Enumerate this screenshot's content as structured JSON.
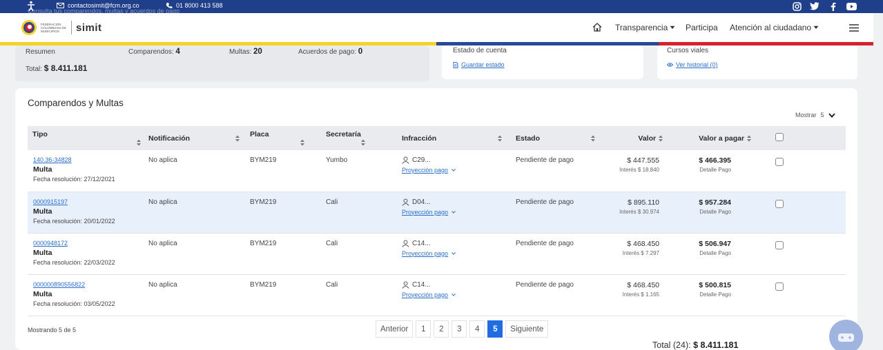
{
  "topbar": {
    "email": "contactosimit@fcm.org.co",
    "phone": "01 8000 413 588",
    "ghost_text": "Consulta tus comparendos, multas y acuerdos de pago"
  },
  "logo": {
    "org_name": "Federación Colombiana de Municipios",
    "brand": "simit"
  },
  "nav": {
    "transparencia": "Transparencia",
    "participa": "Participa",
    "atencion": "Atención al ciudadano"
  },
  "summary": {
    "resumen_label": "Resumen",
    "comparendos_label": "Comparendos:",
    "comparendos_value": "4",
    "multas_label": "Multas:",
    "multas_value": "20",
    "acuerdos_label": "Acuerdos de pago:",
    "acuerdos_value": "0",
    "total_label": "Total:",
    "total_value": "$ 8.411.181"
  },
  "estado_cuenta": {
    "title": "Estado de cuenta",
    "link": "Guardar estado"
  },
  "cursos": {
    "title": "Cursos viales",
    "link": "Ver historial (0)"
  },
  "section": {
    "title": "Comparendos y Multas",
    "mostrar_label": "Mostrar",
    "mostrar_value": "5"
  },
  "table": {
    "headers": {
      "tipo": "Tipo",
      "notificacion": "Notificación",
      "placa": "Placa",
      "secretaria": "Secretaría",
      "infraccion": "Infracción",
      "estado": "Estado",
      "valor": "Valor",
      "valor_pagar": "Valor a pagar"
    },
    "rows": [
      {
        "id": "140.36-34828",
        "tipo": "Multa",
        "fecha": "Fecha resolución: 27/12/2021",
        "notificacion": "No aplica",
        "placa": "BYM219",
        "secretaria": "Yumbo",
        "infraccion": "C29...",
        "proyeccion": "Proyección pago",
        "estado": "Pendiente de pago",
        "valor": "$ 447.555",
        "interes": "Interés $ 18.840",
        "valor_pagar": "$ 466.395",
        "detalle": "Detalle Pago"
      },
      {
        "id": "0000915197",
        "tipo": "Multa",
        "fecha": "Fecha resolución: 20/01/2022",
        "notificacion": "No aplica",
        "placa": "BYM219",
        "secretaria": "Cali",
        "infraccion": "D04...",
        "proyeccion": "Proyección pago",
        "estado": "Pendiente de pago",
        "valor": "$ 895.110",
        "interes": "Interés $ 30.974",
        "valor_pagar": "$ 957.284",
        "detalle": "Detalle Pago"
      },
      {
        "id": "0000948172",
        "tipo": "Multa",
        "fecha": "Fecha resolución: 22/03/2022",
        "notificacion": "No aplica",
        "placa": "BYM219",
        "secretaria": "Cali",
        "infraccion": "C14...",
        "proyeccion": "Proyección pago",
        "estado": "Pendiente de pago",
        "valor": "$ 468.450",
        "interes": "Interés $ 7.297",
        "valor_pagar": "$ 506.947",
        "detalle": "Detalle Pago"
      },
      {
        "id": "000000890556822",
        "tipo": "Multa",
        "fecha": "Fecha resolución: 03/05/2022",
        "notificacion": "No aplica",
        "placa": "BYM219",
        "secretaria": "Cali",
        "infraccion": "C14...",
        "proyeccion": "Proyección pago",
        "estado": "Pendiente de pago",
        "valor": "$ 468.450",
        "interes": "Interés $ 1.165",
        "valor_pagar": "$ 500.815",
        "detalle": "Detalle Pago"
      }
    ]
  },
  "footer": {
    "mostrando": "Mostrando 5 de 5",
    "anterior": "Anterior",
    "pages": [
      "1",
      "2",
      "3",
      "4",
      "5"
    ],
    "active_page": "5",
    "siguiente": "Siguiente",
    "total_label": "Total (24):",
    "total_value": "$ 8.411.181"
  },
  "colors": {
    "topbar": "#1f3f8a",
    "stripe_yellow": "#f5d224",
    "stripe_blue": "#274a96",
    "stripe_red": "#d6202c",
    "link": "#2a6fc9",
    "active_page": "#1f6de0"
  },
  "icons": [
    "accessibility-icon",
    "mail-icon",
    "phone-icon",
    "instagram-icon",
    "twitter-icon",
    "facebook-icon",
    "youtube-icon",
    "home-icon",
    "menu-icon",
    "user-icon",
    "sort-icon",
    "chevron-down-icon",
    "chatbot-icon"
  ]
}
